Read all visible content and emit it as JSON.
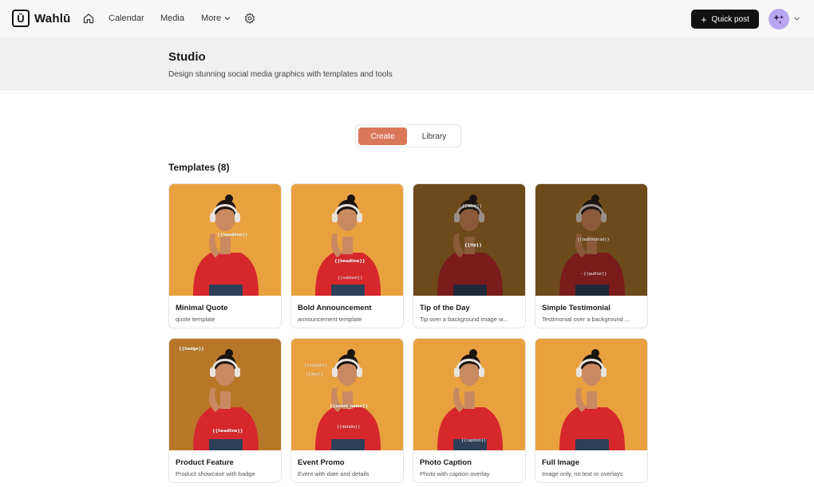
{
  "nav": {
    "logo_mark": "Ū",
    "logo_text": "Wahlū",
    "calendar": "Calendar",
    "media": "Media",
    "more": "More",
    "quick_post": "Quick post",
    "icons": {
      "home": "home-icon",
      "settings": "gear-icon",
      "more_chevron": "chevron-down-icon",
      "plus": "plus-icon",
      "avatar": "sparkle-avatar",
      "avatar_chevron": "chevron-down-icon"
    }
  },
  "header": {
    "title": "Studio",
    "subtitle": "Design stunning social media graphics with templates and tools"
  },
  "toggle": {
    "create": "Create",
    "library": "Library",
    "active": "Create"
  },
  "templates": {
    "heading": "Templates (8)",
    "items": [
      {
        "title": "Minimal Quote",
        "desc": "quote template",
        "bg": "orange",
        "placeholders": [
          "{{headline}}"
        ]
      },
      {
        "title": "Bold Announcement",
        "desc": "announcement template",
        "bg": "orange",
        "placeholders": [
          "{{headline}}",
          "{{subtext}}"
        ]
      },
      {
        "title": "Tip of the Day",
        "desc": "Tip over a background image w...",
        "bg": "brown",
        "placeholders": [
          "{{label}}",
          "{{tip}}"
        ]
      },
      {
        "title": "Simple Testimonial",
        "desc": "Testimonial over a background ...",
        "bg": "brown",
        "placeholders": [
          "{{testimonial}}",
          "- {{author}}"
        ]
      },
      {
        "title": "Product Feature",
        "desc": "Product showcase with badge",
        "bg": "amber",
        "placeholders": [
          "{{badge}}",
          "{{headline}}"
        ]
      },
      {
        "title": "Event Promo",
        "desc": "Event with date and details",
        "bg": "orange",
        "placeholders": [
          "{{month}}",
          "{{day}}",
          "{{event_name}}",
          "{{details}}"
        ]
      },
      {
        "title": "Photo Caption",
        "desc": "Photo with caption overlay",
        "bg": "orange",
        "placeholders": [
          "{{caption}}"
        ]
      },
      {
        "title": "Full Image",
        "desc": "Image only, no text or overlays",
        "bg": "orange",
        "placeholders": []
      }
    ]
  },
  "colors": {
    "accent": "#d97759",
    "primary_button": "#111111",
    "avatar": "#b9a6f2"
  }
}
